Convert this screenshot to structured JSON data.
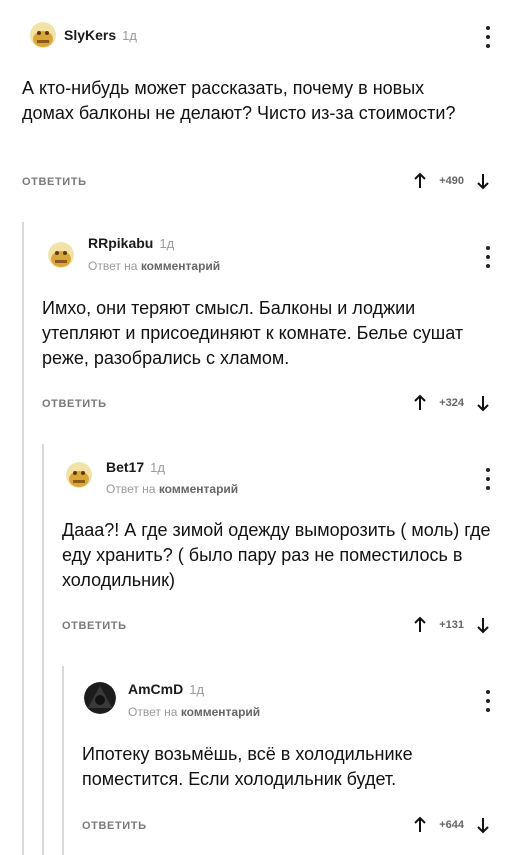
{
  "comments": [
    {
      "user": "SlyKers",
      "time": "1д",
      "reply_to_label": "",
      "reply_to_strong": "",
      "text": "А кто-нибудь может рассказать, почему в новых домах балконы не делают? Чисто из-за стоимости?",
      "reply_label": "ОТВЕТИТЬ",
      "rating": "+490",
      "avatar": "face-avatar"
    },
    {
      "user": "RRpikabu",
      "time": "1д",
      "reply_to_label": "Ответ на",
      "reply_to_strong": "комментарий",
      "text": "Имхо, они теряют смысл. Балконы и лоджии утепляют и присоединяют к комнате. Белье сушат реже, разобрались с хламом.",
      "reply_label": "ОТВЕТИТЬ",
      "rating": "+324",
      "avatar": "face-avatar"
    },
    {
      "user": "Bet17",
      "time": "1д",
      "reply_to_label": "Ответ на",
      "reply_to_strong": "комментарий",
      "text": "Дааа?! А где зимой одежду выморозить ( моль) где еду хранить? ( было пару раз не поместилось в холодильник)",
      "reply_label": "ОТВЕТИТЬ",
      "rating": "+131",
      "avatar": "face-avatar"
    },
    {
      "user": "AmCmD",
      "time": "1д",
      "reply_to_label": "Ответ на",
      "reply_to_strong": "комментарий",
      "text": "Ипотеку возьмёшь, всё в холодильнике поместится. Если холодильник будет.",
      "reply_label": "ОТВЕТИТЬ",
      "rating": "+644",
      "avatar": "dark-avatar"
    }
  ]
}
